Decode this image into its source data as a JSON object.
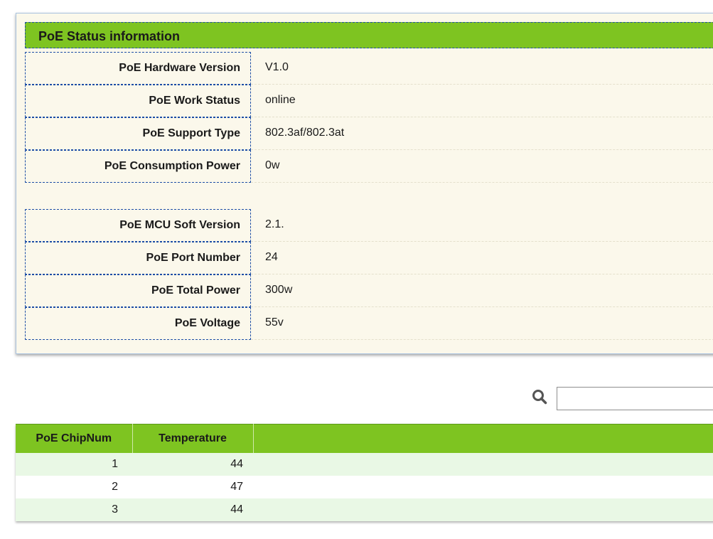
{
  "status_panel": {
    "title": "PoE Status information",
    "group1": [
      {
        "label": "PoE Hardware Version",
        "value": "V1.0"
      },
      {
        "label": "PoE Work Status",
        "value": "online"
      },
      {
        "label": "PoE Support Type",
        "value": "802.3af/802.3at"
      },
      {
        "label": "PoE Consumption Power",
        "value": "0w"
      }
    ],
    "group2": [
      {
        "label": "PoE MCU Soft Version",
        "value": "2.1."
      },
      {
        "label": "PoE Port Number",
        "value": "24"
      },
      {
        "label": "PoE Total Power",
        "value": "300w"
      },
      {
        "label": "PoE Voltage",
        "value": "55v"
      }
    ]
  },
  "search": {
    "icon": "search-icon",
    "value": "",
    "placeholder": ""
  },
  "temperature_table": {
    "columns": [
      "PoE ChipNum",
      "Temperature"
    ],
    "rows": [
      {
        "chip": "1",
        "temperature": "44"
      },
      {
        "chip": "2",
        "temperature": "47"
      },
      {
        "chip": "3",
        "temperature": "44"
      }
    ]
  },
  "colors": {
    "accent_green": "#7ec421",
    "panel_background": "#fbf8eb",
    "dashed_border": "#1d4ea6",
    "row_alt": "#e9f8e5"
  }
}
